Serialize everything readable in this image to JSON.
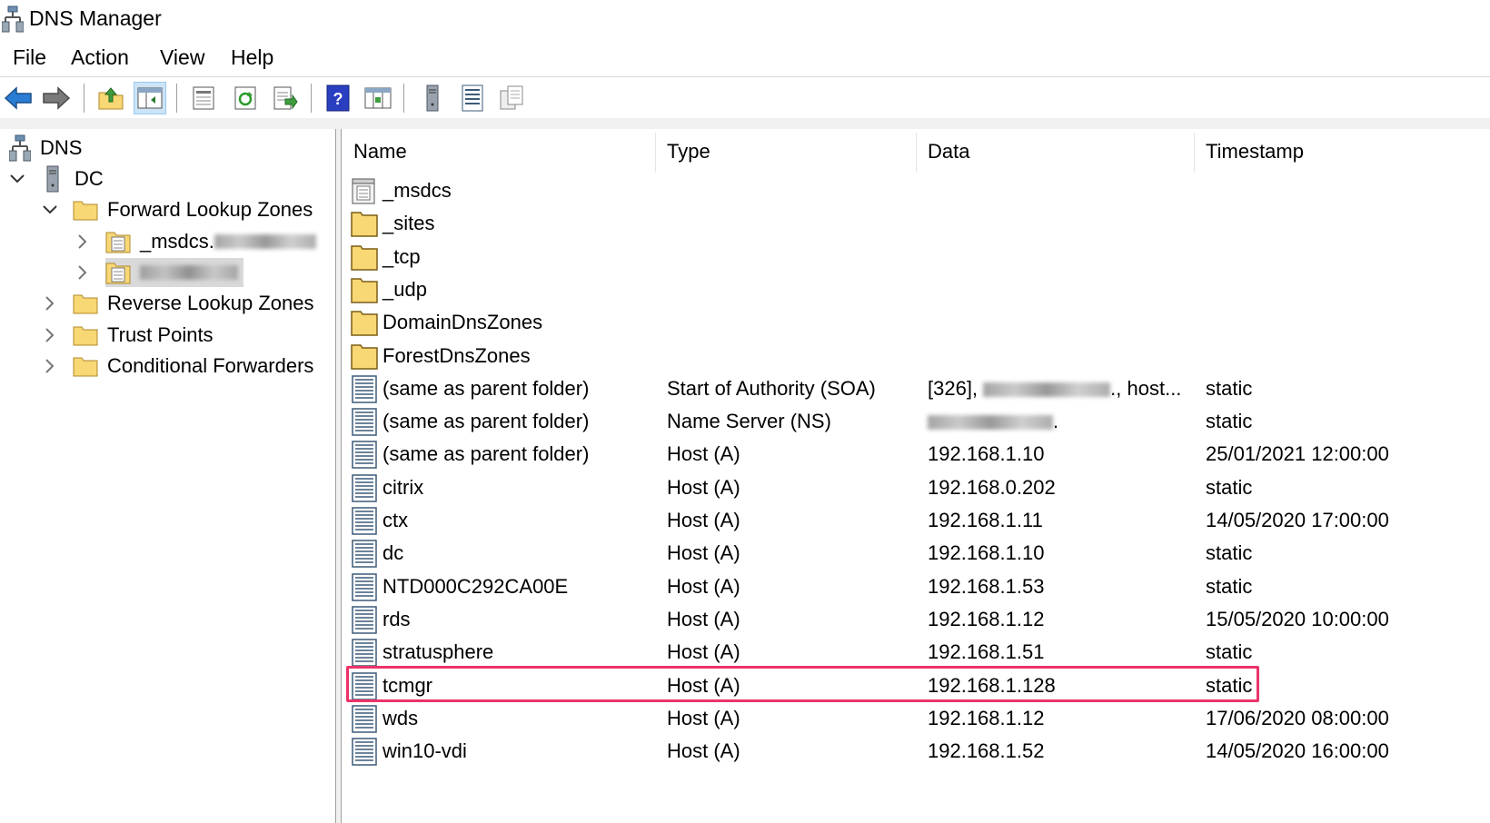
{
  "window": {
    "title": "DNS Manager",
    "icon": "dns-manager-icon"
  },
  "menu": [
    "File",
    "Action",
    "View",
    "Help"
  ],
  "toolbar": [
    "back-icon",
    "forward-icon",
    "up-folder-icon",
    "show-hide-tree-icon",
    "properties-icon",
    "refresh-icon",
    "export-list-icon",
    "help-icon",
    "view-icon",
    "server-icon",
    "record-list-icon",
    "copy-records-icon"
  ],
  "tree": {
    "root": "DNS",
    "server": "DC",
    "forward_zones": "Forward Lookup Zones",
    "zone_msdcs": "_msdcs.",
    "reverse_zones": "Reverse Lookup Zones",
    "trust_points": "Trust Points",
    "conditional_forwarders": "Conditional Forwarders"
  },
  "columns": {
    "name": "Name",
    "type": "Type",
    "data": "Data",
    "timestamp": "Timestamp"
  },
  "records": [
    {
      "name": "_msdcs",
      "type": "",
      "data": "",
      "timestamp": "",
      "icon": "zone-icon"
    },
    {
      "name": "_sites",
      "type": "",
      "data": "",
      "timestamp": "",
      "icon": "folder-icon"
    },
    {
      "name": "_tcp",
      "type": "",
      "data": "",
      "timestamp": "",
      "icon": "folder-icon"
    },
    {
      "name": "_udp",
      "type": "",
      "data": "",
      "timestamp": "",
      "icon": "folder-icon"
    },
    {
      "name": "DomainDnsZones",
      "type": "",
      "data": "",
      "timestamp": "",
      "icon": "folder-icon"
    },
    {
      "name": "ForestDnsZones",
      "type": "",
      "data": "",
      "timestamp": "",
      "icon": "folder-icon"
    },
    {
      "name": "(same as parent folder)",
      "type": "Start of Authority (SOA)",
      "data": "[326], ",
      "data_suffix": "., host...",
      "timestamp": "static",
      "icon": "record-icon"
    },
    {
      "name": "(same as parent folder)",
      "type": "Name Server (NS)",
      "data": "",
      "data_suffix": ".",
      "timestamp": "static",
      "icon": "record-icon"
    },
    {
      "name": "(same as parent folder)",
      "type": "Host (A)",
      "data": "192.168.1.10",
      "timestamp": "25/01/2021 12:00:00",
      "icon": "record-icon"
    },
    {
      "name": "citrix",
      "type": "Host (A)",
      "data": "192.168.0.202",
      "timestamp": "static",
      "icon": "record-icon"
    },
    {
      "name": "ctx",
      "type": "Host (A)",
      "data": "192.168.1.11",
      "timestamp": "14/05/2020 17:00:00",
      "icon": "record-icon"
    },
    {
      "name": "dc",
      "type": "Host (A)",
      "data": "192.168.1.10",
      "timestamp": "static",
      "icon": "record-icon"
    },
    {
      "name": "NTD000C292CA00E",
      "type": "Host (A)",
      "data": "192.168.1.53",
      "timestamp": "static",
      "icon": "record-icon"
    },
    {
      "name": "rds",
      "type": "Host (A)",
      "data": "192.168.1.12",
      "timestamp": "15/05/2020 10:00:00",
      "icon": "record-icon"
    },
    {
      "name": "stratusphere",
      "type": "Host (A)",
      "data": "192.168.1.51",
      "timestamp": "static",
      "icon": "record-icon"
    },
    {
      "name": "tcmgr",
      "type": "Host (A)",
      "data": "192.168.1.128",
      "timestamp": "static",
      "icon": "record-icon"
    },
    {
      "name": "wds",
      "type": "Host (A)",
      "data": "192.168.1.12",
      "timestamp": "17/06/2020 08:00:00",
      "icon": "record-icon"
    },
    {
      "name": "win10-vdi",
      "type": "Host (A)",
      "data": "192.168.1.52",
      "timestamp": "14/05/2020 16:00:00",
      "icon": "record-icon"
    }
  ],
  "highlighted_record": "tcmgr",
  "colors": {
    "highlight_border": "#ec3369",
    "folder": "#f8d775",
    "selection": "#d9d9d9",
    "accent_blue": "#2b7cd3"
  }
}
